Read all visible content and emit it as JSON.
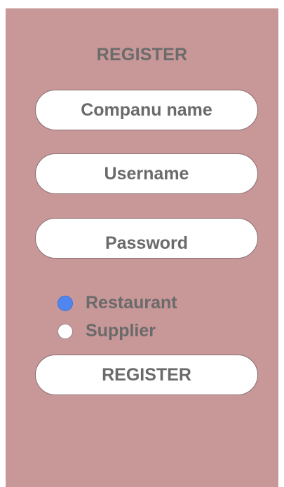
{
  "form": {
    "title": "REGISTER",
    "company_field": "Companu name",
    "username_field": "Username",
    "password_field": "Password",
    "account_types": [
      {
        "label": "Restaurant",
        "selected": true
      },
      {
        "label": "Supplier",
        "selected": false
      }
    ],
    "register_button": "REGISTER"
  },
  "colors": {
    "panel_background": "#c89798",
    "text": "#6a6a6a",
    "selected_radio": "#4f86f0",
    "field_background": "#ffffff"
  }
}
